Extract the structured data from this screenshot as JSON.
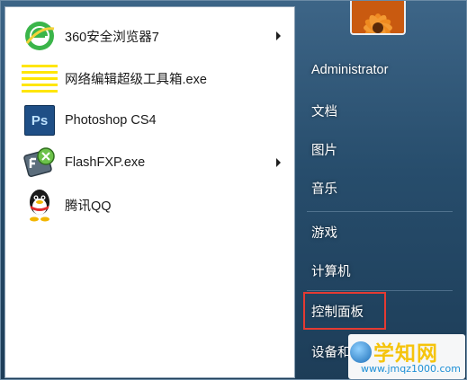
{
  "programs": [
    {
      "label": "360安全浏览器7",
      "icon": "360-browser-icon",
      "has_submenu": true
    },
    {
      "label": "网络编辑超级工具箱.exe",
      "icon": "toolbox-icon",
      "has_submenu": false
    },
    {
      "label": "Photoshop CS4",
      "icon": "photoshop-icon",
      "has_submenu": false
    },
    {
      "label": "FlashFXP.exe",
      "icon": "flashfxp-icon",
      "has_submenu": true
    },
    {
      "label": "腾讯QQ",
      "icon": "qq-penguin-icon",
      "has_submenu": false
    }
  ],
  "photoshop_badge": "Ps",
  "right_pane": {
    "user": "Administrator",
    "documents": "文档",
    "pictures": "图片",
    "music": "音乐",
    "games": "游戏",
    "computer": "计算机",
    "control_panel": "控制面板",
    "devices_partial": "设备和"
  },
  "highlight_color": "#e53a32",
  "watermark": {
    "title": "学知网",
    "url": "www.jmqz1000.com"
  }
}
